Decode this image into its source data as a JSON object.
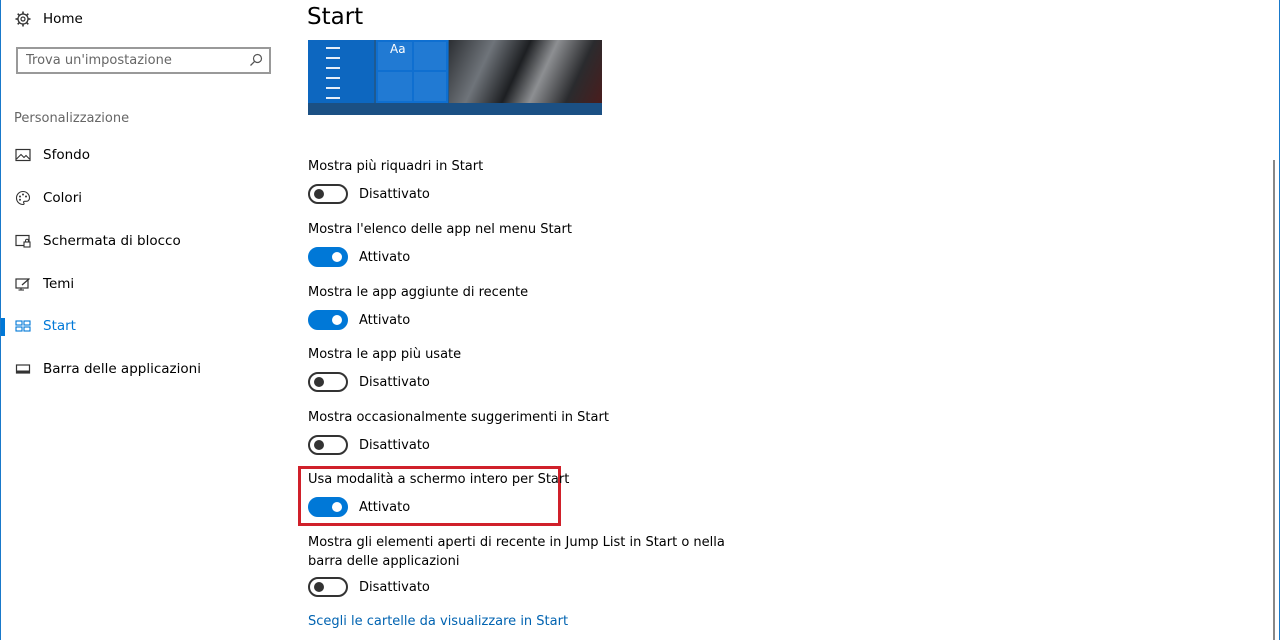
{
  "window": {
    "accent_color": "#0078d7",
    "highlight_color": "#d0202a"
  },
  "sidebar": {
    "home_label": "Home",
    "home_icon": "gear-icon",
    "search_placeholder": "Trova un'impostazione",
    "search_icon": "search-icon",
    "section_title": "Personalizzazione",
    "items": [
      {
        "label": "Sfondo",
        "icon": "picture-icon",
        "active": false
      },
      {
        "label": "Colori",
        "icon": "palette-icon",
        "active": false
      },
      {
        "label": "Schermata di blocco",
        "icon": "lock-screen-icon",
        "active": false
      },
      {
        "label": "Temi",
        "icon": "themes-icon",
        "active": false
      },
      {
        "label": "Start",
        "icon": "start-icon",
        "active": true
      },
      {
        "label": "Barra delle applicazioni",
        "icon": "taskbar-icon",
        "active": false
      }
    ]
  },
  "main": {
    "title": "Start",
    "preview": {
      "tile_label": "Aa"
    },
    "settings": [
      {
        "label": "Mostra più riquadri in Start",
        "state": "Disattivato",
        "on": false
      },
      {
        "label": "Mostra l'elenco delle app nel menu Start",
        "state": "Attivato",
        "on": true
      },
      {
        "label": "Mostra le app aggiunte di recente",
        "state": "Attivato",
        "on": true
      },
      {
        "label": "Mostra le app più usate",
        "state": "Disattivato",
        "on": false
      },
      {
        "label": "Mostra occasionalmente suggerimenti in Start",
        "state": "Disattivato",
        "on": false
      },
      {
        "label": "Usa modalità a schermo intero per Start",
        "state": "Attivato",
        "on": true,
        "highlighted": true
      },
      {
        "label_line1": "Mostra gli elementi aperti di recente in Jump List in Start o nella",
        "label_line2": "barra delle applicazioni",
        "state": "Disattivato",
        "on": false
      }
    ],
    "link": "Scegli le cartelle da visualizzare in Start"
  }
}
